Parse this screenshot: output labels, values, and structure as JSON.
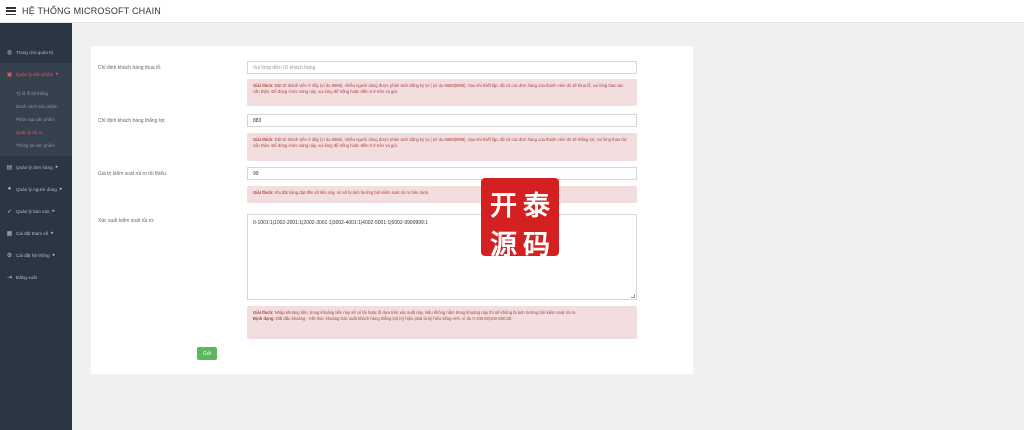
{
  "app": {
    "title": "HỆ THỐNG MICROSOFT CHAIN"
  },
  "sidebar": {
    "items": [
      {
        "label": "Trang chủ quản trị",
        "icon": "dashboard-icon"
      },
      {
        "label": "Quản lý sản phẩm",
        "icon": "product-icon",
        "active": true,
        "children": [
          {
            "label": "Tỷ lệ lỗ lãi thống"
          },
          {
            "label": "Danh sách sản phẩm"
          },
          {
            "label": "Phân loại sản phẩm"
          },
          {
            "label": "Quản lý rủi ro",
            "current": true
          },
          {
            "label": "Thông tin sản phẩm"
          }
        ]
      },
      {
        "label": "Quản lý đơn hàng",
        "icon": "order-icon"
      },
      {
        "label": "Quản lý người dùng",
        "icon": "user-icon"
      },
      {
        "label": "Quản lý báo cáo",
        "icon": "report-icon"
      },
      {
        "label": "Cài đặt tham số",
        "icon": "settings-icon"
      },
      {
        "label": "Cài đặt hệ thống",
        "icon": "system-icon"
      },
      {
        "label": "Đăng xuất",
        "icon": "logout-icon"
      }
    ]
  },
  "form": {
    "loss_customer": {
      "label": "Chỉ định khách hàng thua lỗ:",
      "placeholder": "Vui lòng điền ID khách hàng",
      "value": "",
      "hint_title": "Giải thích:",
      "hint_text": "Đặt ID thành viên ở đây (ví dụ 8888), nhiều người dùng được phân tách bằng ký tự | (ví dụ 8888|9999). Sau khi thiết lập, tất cả các đơn hàng của thành viên đó sẽ thua lỗ, vui lòng thao tác cẩn thận. Để đóng chức năng này, vui lòng để trống hoặc điền 0 ở trên và gửi."
    },
    "win_customer": {
      "label": "Chỉ định khách hàng thắng lợi:",
      "value": "883",
      "hint_title": "Giải thích:",
      "hint_text": "Đặt ID thành viên ở đây (ví dụ 8888), nhiều người dùng được phân tách bằng ký tự | (ví dụ 8888|9999). Sau khi thiết lập, tất cả các đơn hàng của thành viên đó sẽ thắng lợi, vui lòng thao tác cẩn thận. Để đóng chức năng này, vui lòng để trống hoặc điền 0 ở trên và gửi."
    },
    "min_risk": {
      "label": "Giá trị kiểm soát rủi ro tối thiểu:",
      "value": "99",
      "hint_title": "Giải thích:",
      "hint_text": "Khi đặt hàng đạt đến số tiền này, nó sẽ bị ảnh hưởng bởi kiểm soát rủi ro bên dưới."
    },
    "risk_prob": {
      "label": "Xác suất kiểm soát rủi ro:",
      "value": "0-1001:1|1002-2001:1|2002-3001:1|3002-4001:1|4002-5001:1|5002-9999999:1",
      "hint_title": "Giải thích:",
      "hint_text": "Nhập khoảng tiền, trong khoảng tiền này sẽ có lãi hoặc lỗ dựa trên xác suất này. Nếu không nằm trong khoảng này thì sẽ không bị ảnh hưởng bởi kiểm soát rủi ro.",
      "format_title": "Định dạng:",
      "format_text": "Bắt đầu khoảng - Kết thúc khoảng:Xác suất khách hàng thắng lợi| Ký hiệu phải là ký hiệu tiếng Anh, ví dụ 0-100:50|100-200:30"
    },
    "submit_label": "Gửi"
  },
  "stamp": {
    "chars": [
      "开",
      "泰",
      "源",
      "码"
    ],
    "color": "#d42020"
  },
  "colors": {
    "sidebar": "#2b3643",
    "accent": "#e05a5a",
    "hint_bg": "#f2dede",
    "hint_text": "#a94442",
    "button": "#5cb85c"
  }
}
